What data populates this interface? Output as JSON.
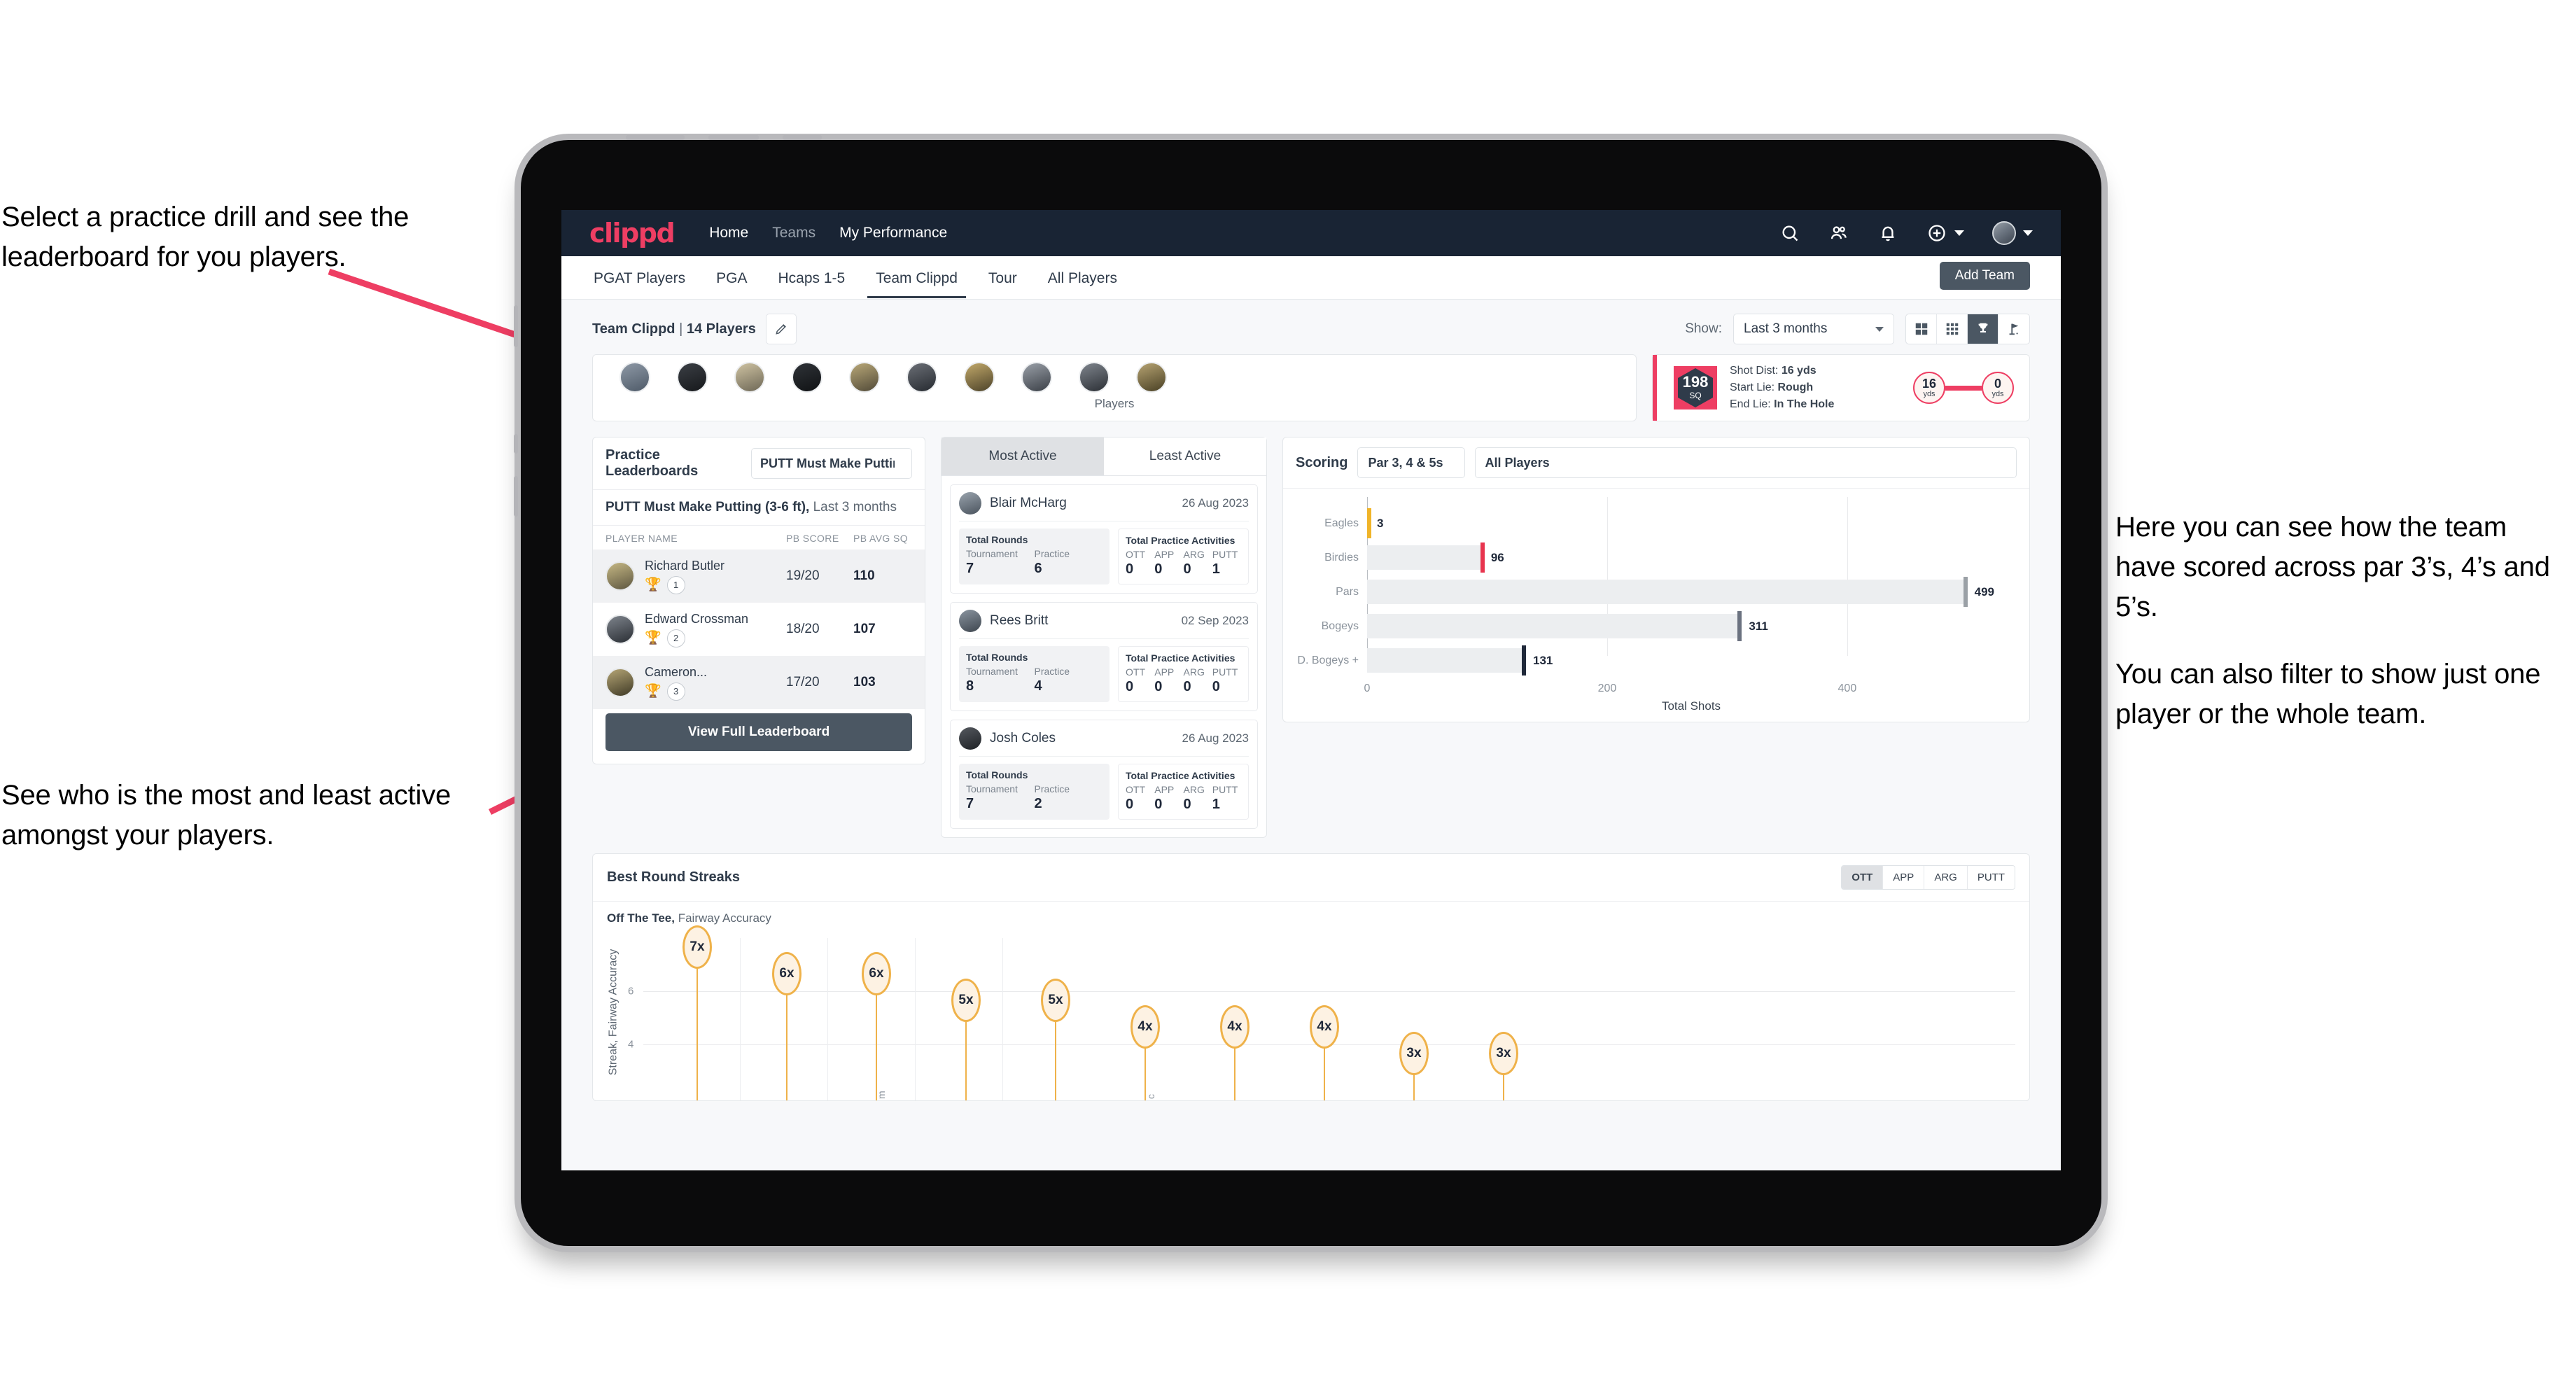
{
  "annotations": {
    "top_left": "Select a practice drill and see the leaderboard for you players.",
    "bottom_left": "See who is the most and least active amongst your players.",
    "right_1": "Here you can see how the team have scored across par 3’s, 4’s and 5’s.",
    "right_2": "You can also filter to show just one player or the whole team.",
    "arrow_color": "#ee3e63"
  },
  "navbar": {
    "logo": "clippd",
    "links": [
      {
        "label": "Home",
        "active": true
      },
      {
        "label": "Teams",
        "active": false
      },
      {
        "label": "My Performance",
        "active": true
      }
    ],
    "icons": [
      "search-icon",
      "people-icon",
      "bell-icon",
      "plus-circle-icon",
      "avatar"
    ]
  },
  "subnav": {
    "tabs": [
      {
        "label": "PGAT Players",
        "active": false
      },
      {
        "label": "PGA",
        "active": false
      },
      {
        "label": "Hcaps 1-5",
        "active": false
      },
      {
        "label": "Team Clippd",
        "active": true
      },
      {
        "label": "Tour",
        "active": false
      },
      {
        "label": "All Players",
        "active": false
      }
    ],
    "add_team_label": "Add Team"
  },
  "teambar": {
    "team_name": "Team Clippd",
    "separator": " | ",
    "players_count": "14 Players",
    "edit_icon": "pencil-icon",
    "show_label": "Show:",
    "range_value": "Last 3 months",
    "view_modes": [
      "grid-large-icon",
      "grid-small-icon",
      "trophy-icon",
      "flag-icon"
    ],
    "active_view_index": 2
  },
  "players_strip": {
    "axis_label": "Players",
    "avatar_count": 10
  },
  "shot_card": {
    "badge_value": "198",
    "badge_unit": "SQ",
    "lines": [
      {
        "key": "Shot Dist:",
        "value": "16 yds"
      },
      {
        "key": "Start Lie:",
        "value": "Rough"
      },
      {
        "key": "End Lie:",
        "value": "In The Hole"
      }
    ],
    "start_value": "16",
    "start_unit": "yds",
    "end_value": "0",
    "end_unit": "yds"
  },
  "leaderboard": {
    "title": "Practice Leaderboards",
    "drill_selected": "PUTT Must Make Putting ...",
    "subtitle_bold": "PUTT Must Make Putting (3-6 ft),",
    "subtitle_light": " Last 3 months",
    "columns": [
      "PLAYER NAME",
      "PB SCORE",
      "PB AVG SQ"
    ],
    "rows": [
      {
        "name": "Richard Butler",
        "rank": "1",
        "trophy": "🏆",
        "pb_score": "19/20",
        "pb_avg_sq": "110"
      },
      {
        "name": "Edward Crossman",
        "rank": "2",
        "trophy": "🏆",
        "pb_score": "18/20",
        "pb_avg_sq": "107"
      },
      {
        "name": "Cameron...",
        "rank": "3",
        "trophy": "🏆",
        "pb_score": "17/20",
        "pb_avg_sq": "103"
      }
    ],
    "button_label": "View Full Leaderboard"
  },
  "activity": {
    "tabs": [
      {
        "label": "Most Active",
        "active": true
      },
      {
        "label": "Least Active",
        "active": false
      }
    ],
    "rounds_title": "Total Rounds",
    "rounds_keys": [
      "Tournament",
      "Practice"
    ],
    "practice_title": "Total Practice Activities",
    "practice_keys": [
      "OTT",
      "APP",
      "ARG",
      "PUTT"
    ],
    "cards": [
      {
        "name": "Blair McHarg",
        "date": "26 Aug 2023",
        "tournament": "7",
        "practice": "6",
        "ott": "0",
        "app": "0",
        "arg": "0",
        "putt": "1"
      },
      {
        "name": "Rees Britt",
        "date": "02 Sep 2023",
        "tournament": "8",
        "practice": "4",
        "ott": "0",
        "app": "0",
        "arg": "0",
        "putt": "0"
      },
      {
        "name": "Josh Coles",
        "date": "26 Aug 2023",
        "tournament": "7",
        "practice": "2",
        "ott": "0",
        "app": "0",
        "arg": "0",
        "putt": "1"
      }
    ]
  },
  "scoring": {
    "title": "Scoring",
    "par_filter": "Par 3, 4 & 5s",
    "player_filter": "All Players"
  },
  "streaks": {
    "title": "Best Round Streaks",
    "segments": [
      {
        "label": "OTT",
        "active": true
      },
      {
        "label": "APP",
        "active": false
      },
      {
        "label": "ARG",
        "active": false
      },
      {
        "label": "PUTT",
        "active": false
      }
    ],
    "sub_bold": "Off The Tee,",
    "sub_light": " Fairway Accuracy"
  },
  "chart_data": [
    {
      "type": "bar",
      "orientation": "horizontal",
      "title": "Scoring",
      "categories": [
        "Eagles",
        "Birdies",
        "Pars",
        "Bogeys",
        "D. Bogeys +"
      ],
      "values": [
        3,
        96,
        499,
        311,
        131
      ],
      "bar_colors": [
        "#f0b429",
        "#e8344e",
        "#9aa0a6",
        "#6b7280",
        "#20293a"
      ],
      "xlabel": "Total Shots",
      "ylabel": "",
      "xlim": [
        0,
        540
      ],
      "xticks": [
        0,
        200,
        400
      ],
      "grid": true,
      "legend": "none"
    },
    {
      "type": "bar",
      "orientation": "vertical",
      "title": "Best Round Streaks",
      "subtitle": "Off The Tee, Fairway Accuracy",
      "ylabel": "Streak, Fairway Accuracy",
      "categories": [
        "1",
        "2",
        "3",
        "4",
        "5",
        "6",
        "7",
        "8",
        "9",
        "10"
      ],
      "values": [
        7,
        6,
        6,
        5,
        5,
        4,
        4,
        4,
        3,
        3
      ],
      "labels": [
        "7x",
        "6x",
        "6x",
        "5x",
        "5x",
        "4x",
        "4x",
        "4x",
        "3x",
        "3x"
      ],
      "ylim": [
        0,
        8
      ],
      "yticks": [
        4,
        6
      ],
      "marker": "lollipop",
      "color": "#efb24a",
      "grid": true
    }
  ]
}
